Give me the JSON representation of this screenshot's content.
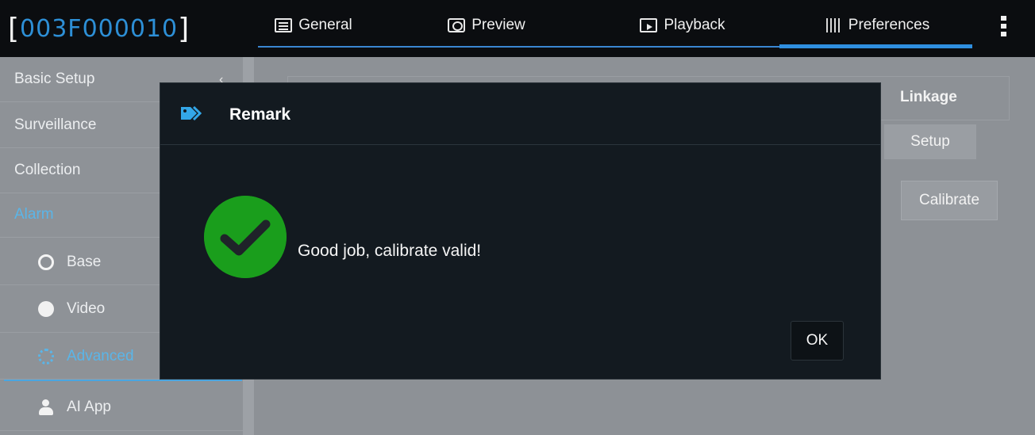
{
  "header": {
    "device_id": "003F000010",
    "tabs": [
      {
        "label": "General",
        "icon": "list-window-icon"
      },
      {
        "label": "Preview",
        "icon": "eye-monitor-icon"
      },
      {
        "label": "Playback",
        "icon": "play-window-icon"
      },
      {
        "label": "Preferences",
        "icon": "sliders-icon"
      }
    ],
    "active_tab": "Preferences",
    "accent_color": "#2f8fe0"
  },
  "sidebar": {
    "items": [
      {
        "label": "Basic Setup"
      },
      {
        "label": "Surveillance"
      },
      {
        "label": "Collection"
      },
      {
        "label": "Alarm",
        "active": true
      },
      {
        "label": "Base",
        "icon": "ring-icon"
      },
      {
        "label": "Video",
        "icon": "globe-icon"
      },
      {
        "label": "Advanced",
        "icon": "spinner-icon",
        "active": true
      },
      {
        "label": "AI App",
        "icon": "person-icon"
      }
    ],
    "caret": "‹"
  },
  "panel": {
    "linkage_label": "Linkage",
    "setup_label": "Setup",
    "calibrate_label": "Calibrate"
  },
  "dialog": {
    "title": "Remark",
    "message": "Good job, calibrate valid!",
    "ok_label": "OK",
    "status_color": "#1a9e1c",
    "icon": "check-circle-icon"
  }
}
